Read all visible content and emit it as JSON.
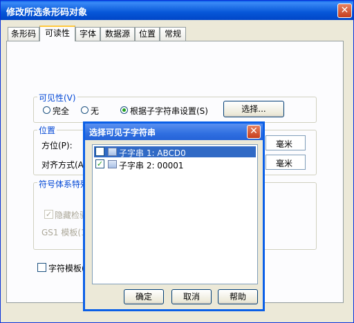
{
  "main": {
    "title": "修改所选条形码对象",
    "tabs": [
      "条形码",
      "可读性",
      "字体",
      "数据源",
      "位置",
      "常规"
    ],
    "visibility": {
      "label": "可见性(V)",
      "options": [
        "完全",
        "无",
        "根据子字符串设置(S)"
      ],
      "selected": 2,
      "select_button": "选择..."
    },
    "position": {
      "label": "位置",
      "direction_label": "方位(P):",
      "align_label": "对齐方式(A)",
      "unit1": "毫米",
      "unit2": "毫米"
    },
    "symbology": {
      "label": "符号体系特殊",
      "hide_check_label": "隐藏检验",
      "gs1_label": "GS1 模板(1)"
    },
    "char_template_label": "字符模板("
  },
  "dialog": {
    "title": "选择可见子字符串",
    "items": [
      {
        "label": "子字串 1: ABCD0",
        "checked": false,
        "selected": true
      },
      {
        "label": "子字串 2: 00001",
        "checked": true,
        "selected": false
      }
    ],
    "buttons": {
      "ok": "确定",
      "cancel": "取消",
      "help": "帮助"
    }
  },
  "colors": {
    "accent": "#316ac5",
    "titlebar": "#0a5fe7"
  }
}
